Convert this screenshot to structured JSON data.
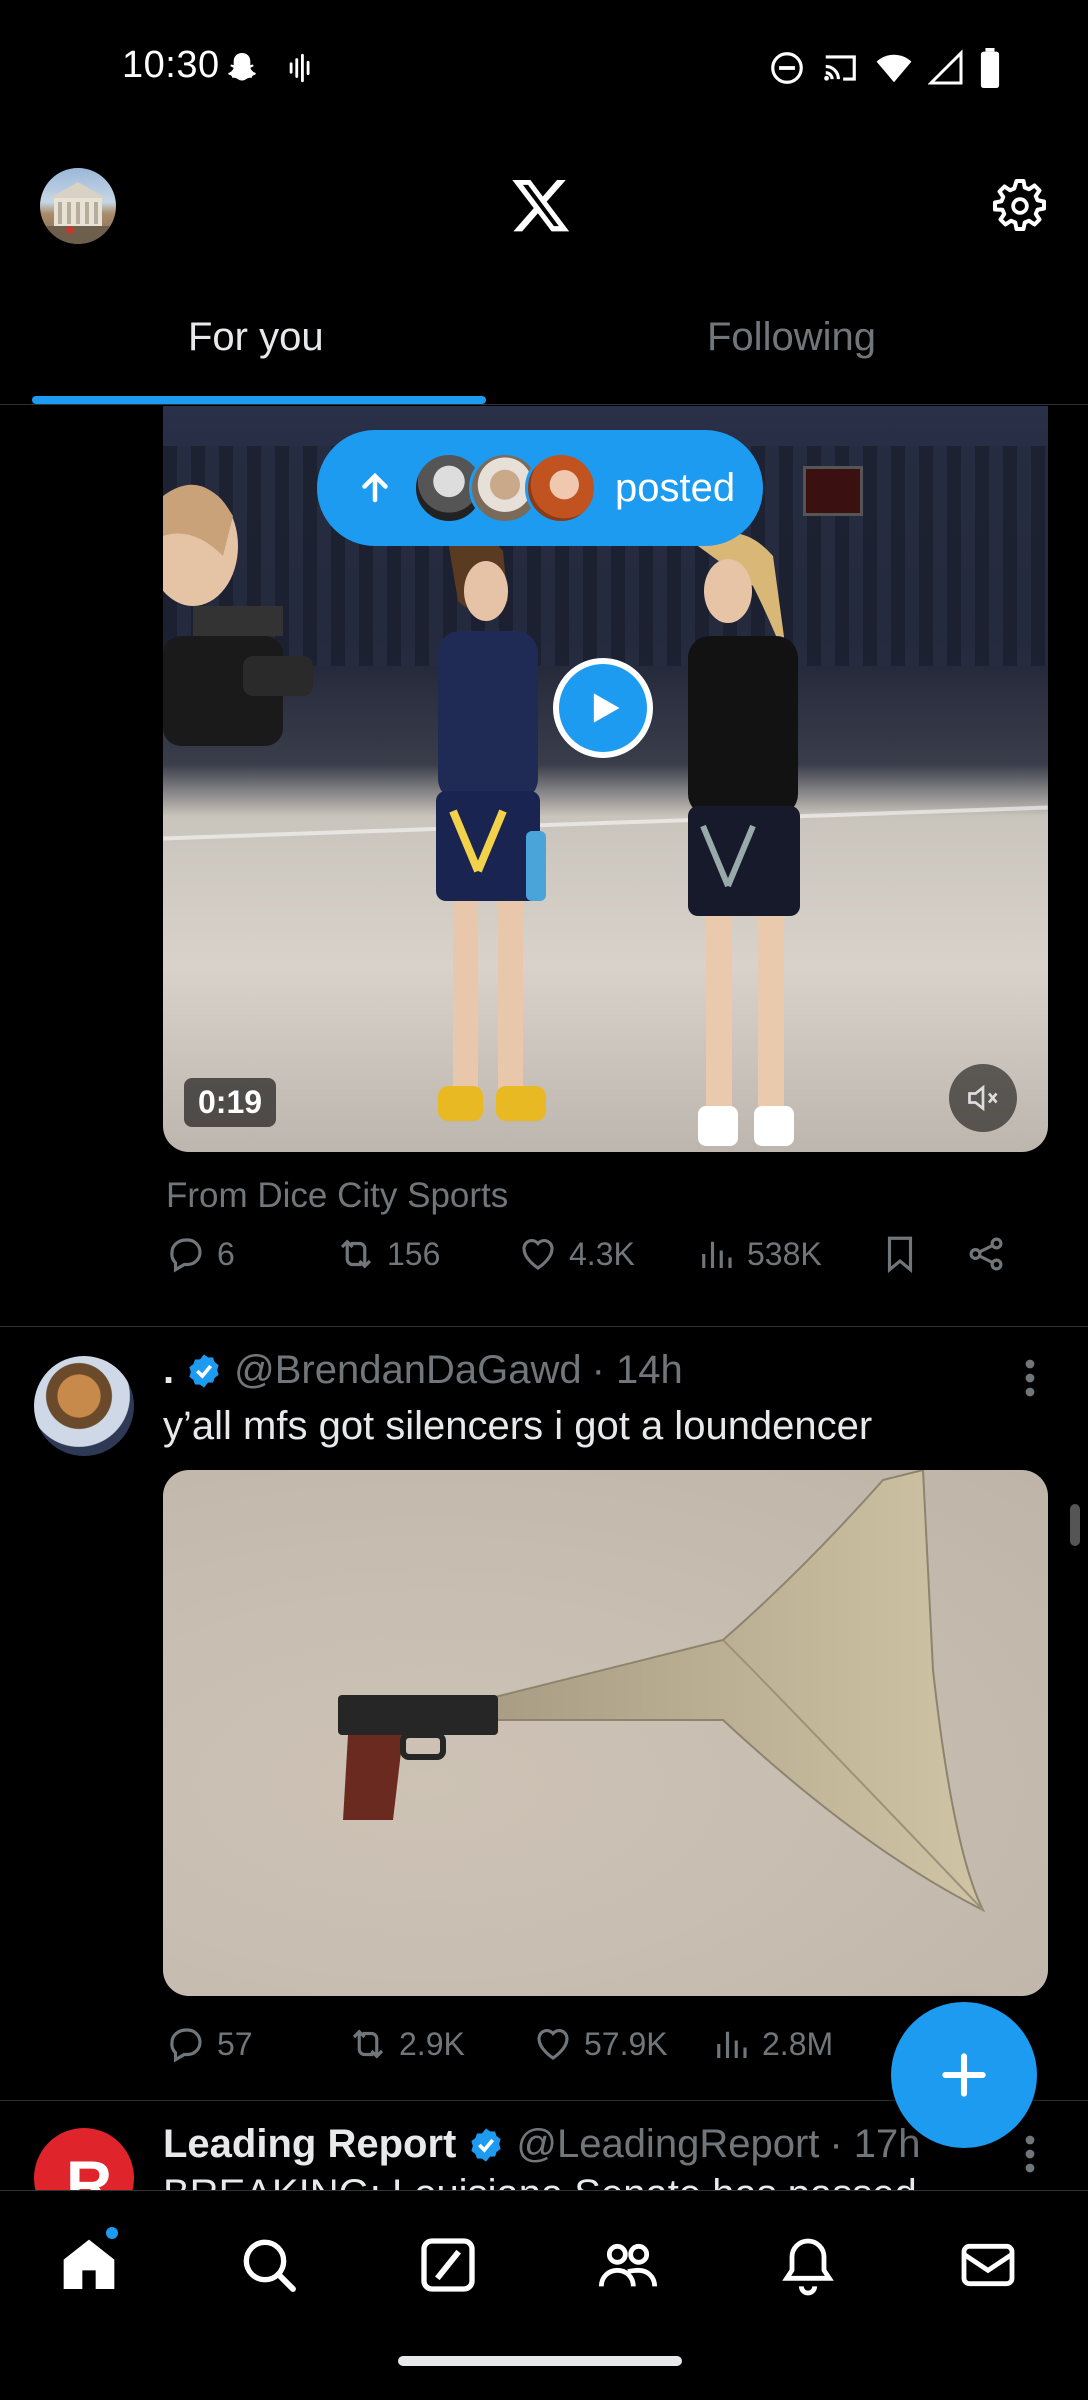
{
  "status_bar": {
    "time": "10:30",
    "left_icons": [
      "snapchat-icon",
      "voice-icon"
    ],
    "right_icons": [
      "dnd-icon",
      "cast-icon",
      "wifi-icon",
      "signal-icon",
      "battery-icon"
    ]
  },
  "header": {
    "logo": "x-logo-icon",
    "settings_icon": "gear-icon"
  },
  "tabs": [
    {
      "label": "For you",
      "active": true
    },
    {
      "label": "Following",
      "active": false
    }
  ],
  "colors": {
    "accent": "#1d9bf0",
    "background": "#000000",
    "text_primary": "#e7e9ea",
    "text_secondary": "#71767b",
    "divider": "#2f3336"
  },
  "posted_pill": {
    "label": "posted"
  },
  "post1": {
    "video_duration": "0:19",
    "from_line": "From Dice City Sports",
    "actions": {
      "replies": "6",
      "reposts": "156",
      "likes": "4.3K",
      "views": "538K"
    }
  },
  "post2": {
    "display_name": ".",
    "verified": true,
    "handle": "@BrendanDaGawd",
    "time": "· 14h",
    "text": "y’all mfs got silencers i got a loundencer",
    "actions": {
      "replies": "57",
      "reposts": "2.9K",
      "likes": "57.9K",
      "views": "2.8M"
    }
  },
  "post3": {
    "display_name": "Leading Report",
    "verified": true,
    "handle": "@LeadingReport",
    "time": "· 17h",
    "text": "BREAKING: Louisiana Senate has passed"
  },
  "bottom_nav": [
    "home-icon",
    "search-icon",
    "grok-icon",
    "communities-icon",
    "notifications-icon",
    "messages-icon"
  ]
}
